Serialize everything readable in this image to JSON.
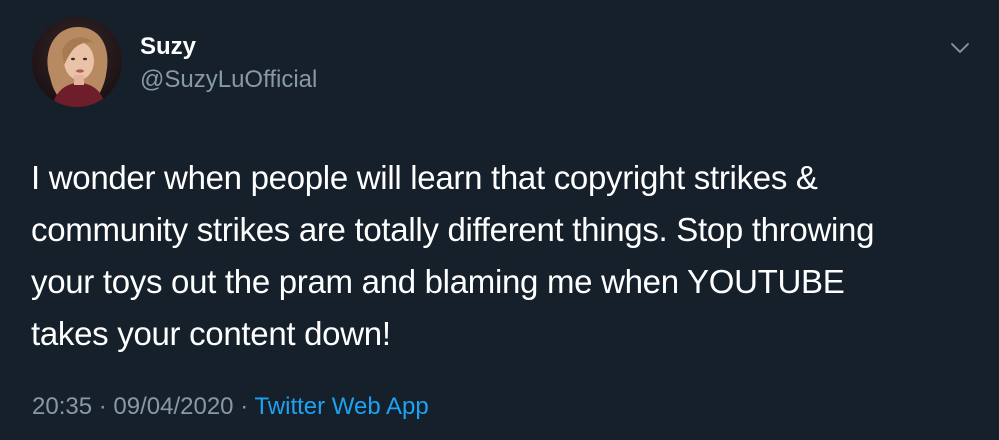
{
  "tweet": {
    "author": {
      "display_name": "Suzy",
      "handle": "@SuzyLuOfficial",
      "avatar_icon": "user-avatar-photo"
    },
    "menu_icon": "chevron-down-icon",
    "text": "I wonder when people will learn that copyright strikes &\ncommunity strikes are totally different things. Stop throwing\nyour toys out the pram and blaming me when YOUTUBE\ntakes your content down!",
    "time": "20:35",
    "date": "09/04/2020",
    "separator": "·",
    "source": "Twitter Web App"
  },
  "colors": {
    "background": "#15202b",
    "primary_text": "#ffffff",
    "secondary_text": "#8899a6",
    "link": "#1da1f2"
  }
}
